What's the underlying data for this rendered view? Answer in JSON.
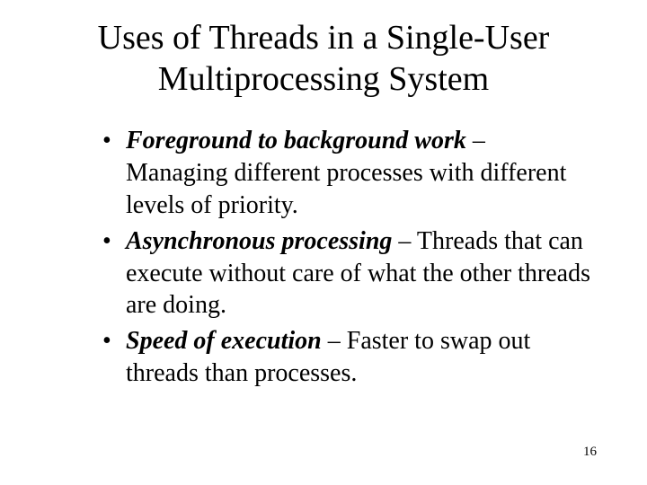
{
  "title": "Uses of Threads in a Single-User Multiprocessing System",
  "bullets": [
    {
      "term": "Foreground to background work",
      "dash": " – ",
      "desc": "Managing different processes with different levels of priority."
    },
    {
      "term": "Asynchronous processing",
      "dash": " – ",
      "desc": "Threads that can execute without care of what the other threads are doing."
    },
    {
      "term": "Speed of execution",
      "dash": " – ",
      "desc": "Faster to swap out threads than processes."
    }
  ],
  "page_number": "16"
}
